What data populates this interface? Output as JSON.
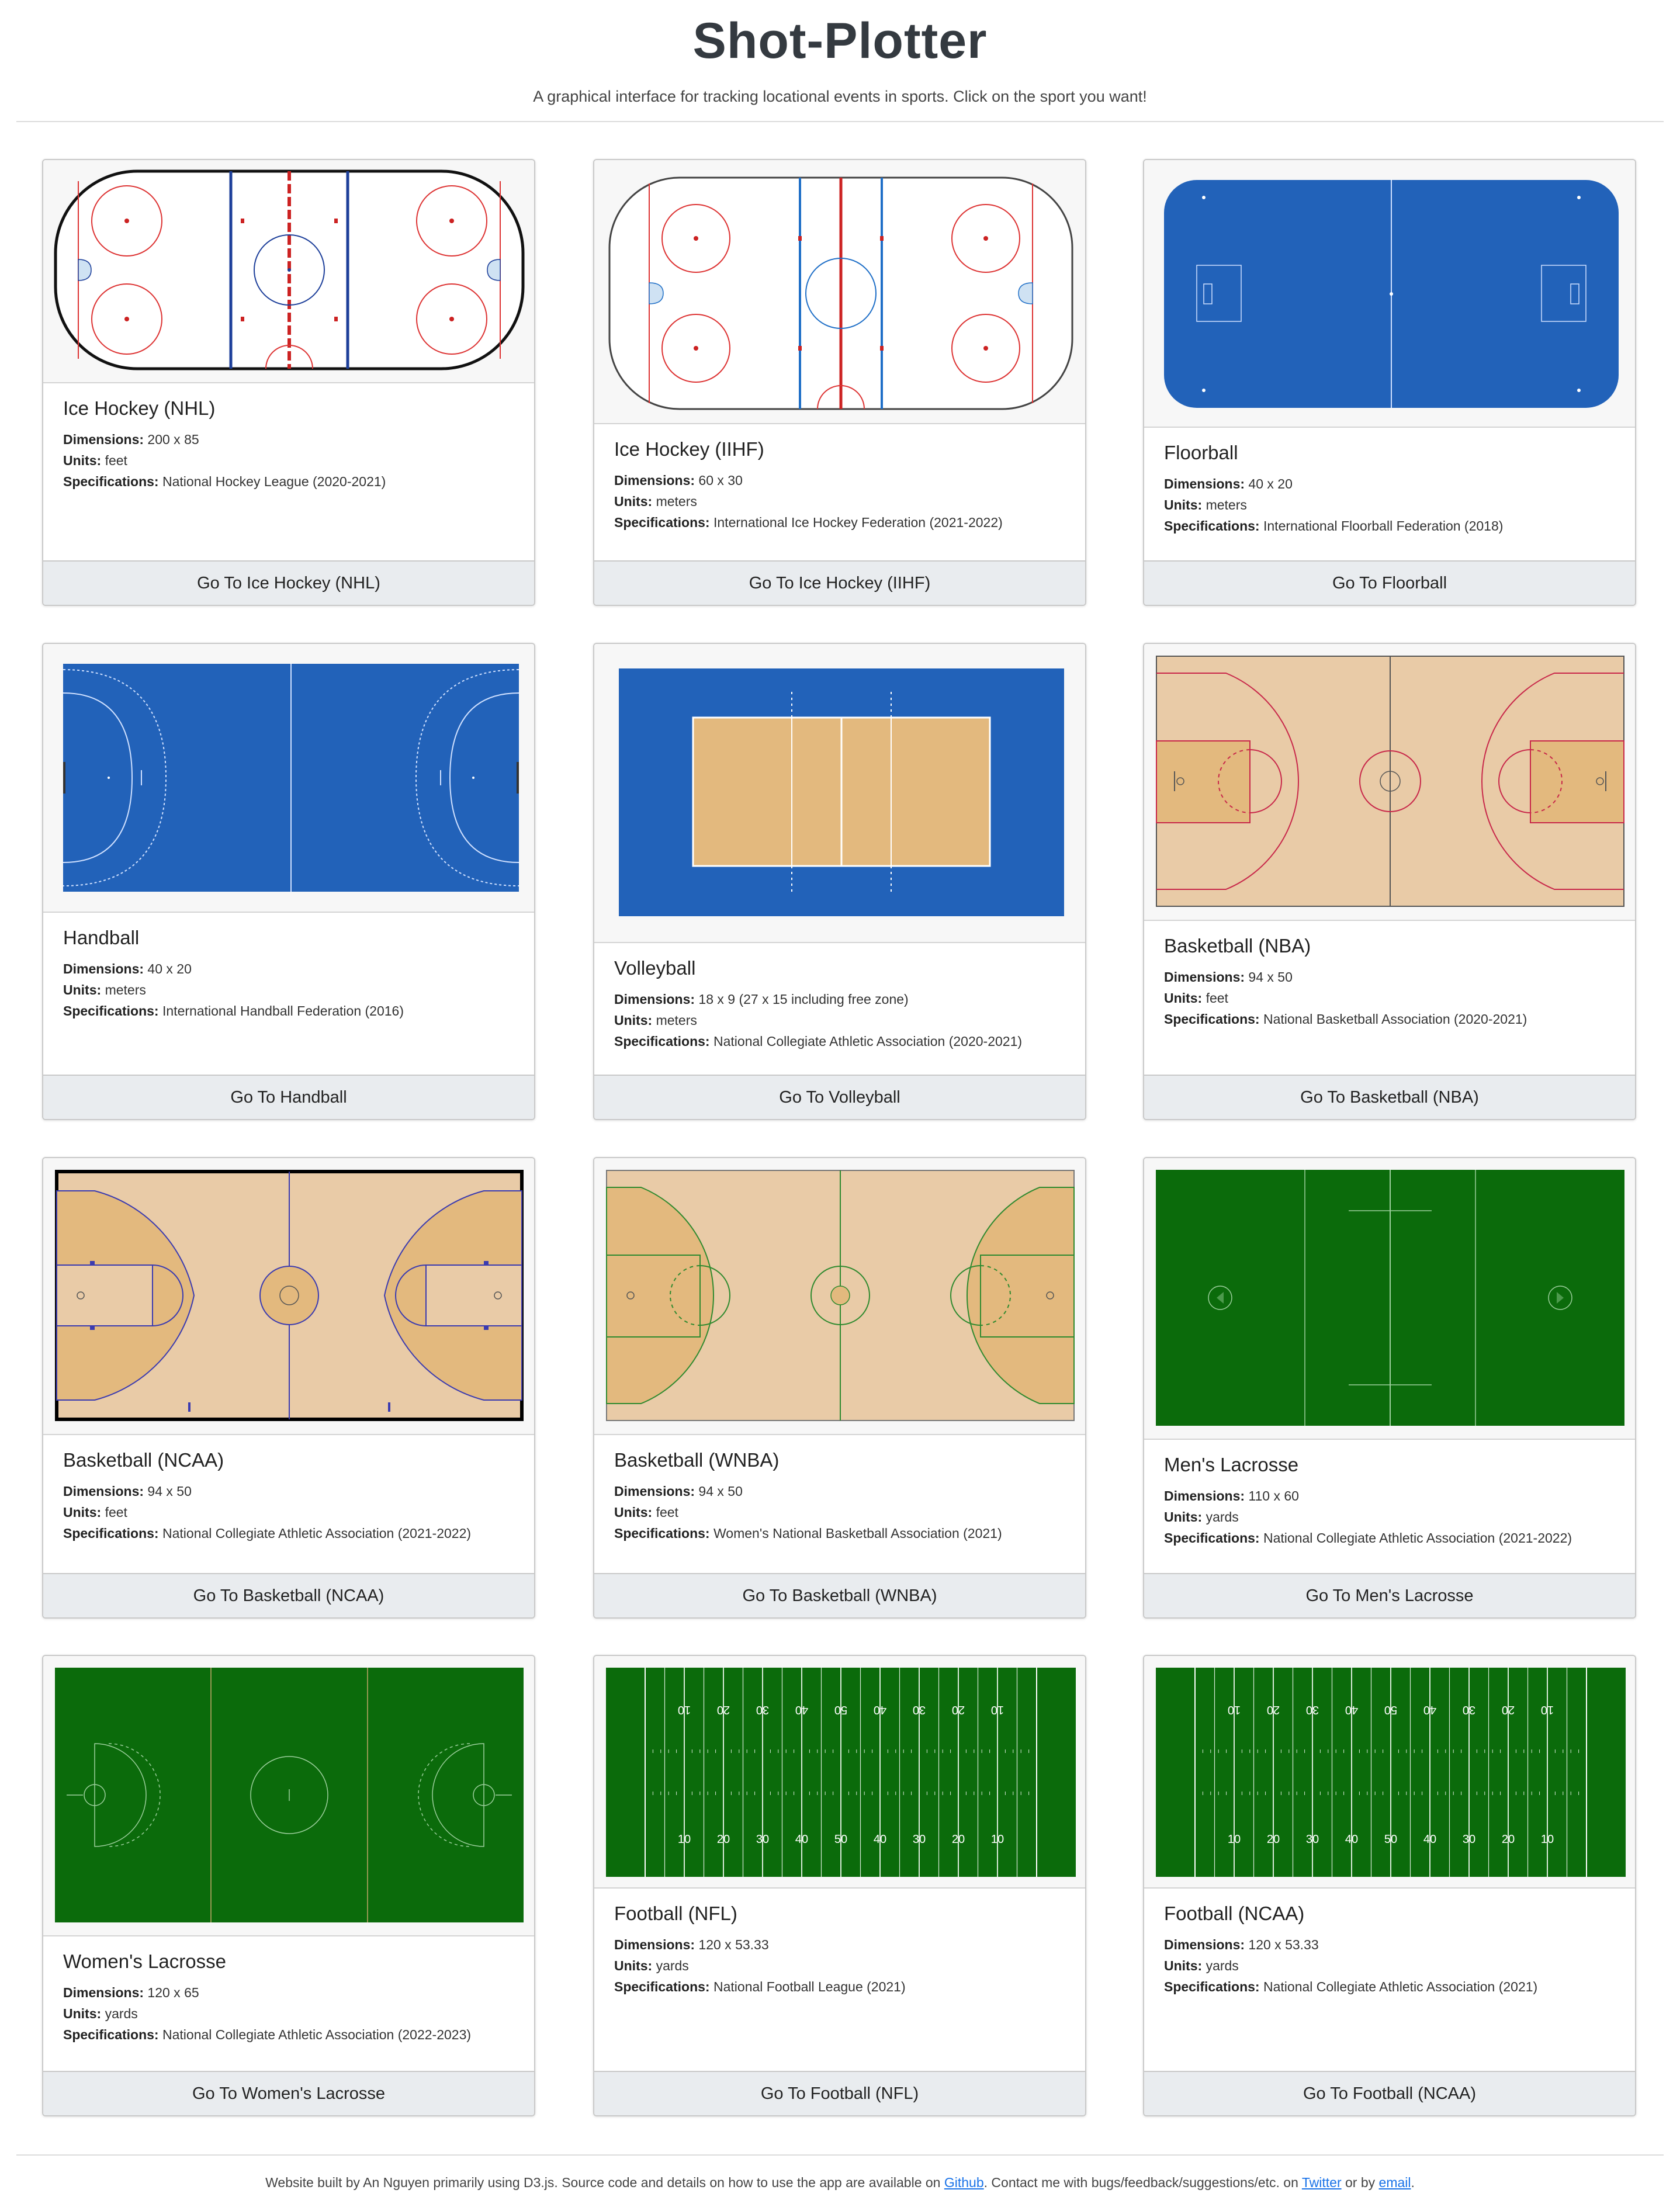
{
  "header": {
    "title": "Shot-Plotter",
    "subtitle": "A graphical interface for tracking locational events in sports. Click on the sport you want!"
  },
  "labels": {
    "dimensions": "Dimensions:",
    "units": "Units:",
    "specifications": "Specifications:"
  },
  "cards": [
    {
      "title": "Ice Hockey (NHL)",
      "dimensions": "200 x 85",
      "units": "feet",
      "specifications": "National Hockey League (2020-2021)",
      "button": "Go To Ice Hockey (NHL)"
    },
    {
      "title": "Ice Hockey (IIHF)",
      "dimensions": "60 x 30",
      "units": "meters",
      "specifications": "International Ice Hockey Federation (2021-2022)",
      "button": "Go To Ice Hockey (IIHF)"
    },
    {
      "title": "Floorball",
      "dimensions": "40 x 20",
      "units": "meters",
      "specifications": "International Floorball Federation (2018)",
      "button": "Go To Floorball"
    },
    {
      "title": "Handball",
      "dimensions": "40 x 20",
      "units": "meters",
      "specifications": "International Handball Federation (2016)",
      "button": "Go To Handball"
    },
    {
      "title": "Volleyball",
      "dimensions": "18 x 9 (27 x 15 including free zone)",
      "units": "meters",
      "specifications": "National Collegiate Athletic Association (2020-2021)",
      "button": "Go To Volleyball"
    },
    {
      "title": "Basketball (NBA)",
      "dimensions": "94 x 50",
      "units": "feet",
      "specifications": "National Basketball Association (2020-2021)",
      "button": "Go To Basketball (NBA)"
    },
    {
      "title": "Basketball (NCAA)",
      "dimensions": "94 x 50",
      "units": "feet",
      "specifications": "National Collegiate Athletic Association (2021-2022)",
      "button": "Go To Basketball (NCAA)"
    },
    {
      "title": "Basketball (WNBA)",
      "dimensions": "94 x 50",
      "units": "feet",
      "specifications": "Women's National Basketball Association (2021)",
      "button": "Go To Basketball (WNBA)"
    },
    {
      "title": "Men's Lacrosse",
      "dimensions": "110 x 60",
      "units": "yards",
      "specifications": "National Collegiate Athletic Association (2021-2022)",
      "button": "Go To Men's Lacrosse"
    },
    {
      "title": "Women's Lacrosse",
      "dimensions": "120 x 65",
      "units": "yards",
      "specifications": "National Collegiate Athletic Association (2022-2023)",
      "button": "Go To Women's Lacrosse"
    },
    {
      "title": "Football (NFL)",
      "dimensions": "120 x 53.33",
      "units": "yards",
      "specifications": "National Football League (2021)",
      "button": "Go To Football (NFL)"
    },
    {
      "title": "Football (NCAA)",
      "dimensions": "120 x 53.33",
      "units": "yards",
      "specifications": "National Collegiate Athletic Association (2021)",
      "button": "Go To Football (NCAA)"
    }
  ],
  "football": {
    "yard_numbers": [
      "10",
      "20",
      "30",
      "40",
      "50",
      "40",
      "30",
      "20",
      "10"
    ]
  },
  "colors": {
    "court_blue": "#2262b9",
    "hardwood": "#e9cba7",
    "paint": "#e3b97e",
    "field_green": "#0b6b0b",
    "link": "#1a73e8"
  },
  "footer": {
    "text1": "Website built by An Nguyen primarily using D3.js. Source code and details on how to use the app are available on ",
    "github": "Github",
    "text2": ". Contact me with bugs/feedback/suggestions/etc. on ",
    "twitter": "Twitter",
    "text3": " or by ",
    "email": "email",
    "text4": "."
  }
}
